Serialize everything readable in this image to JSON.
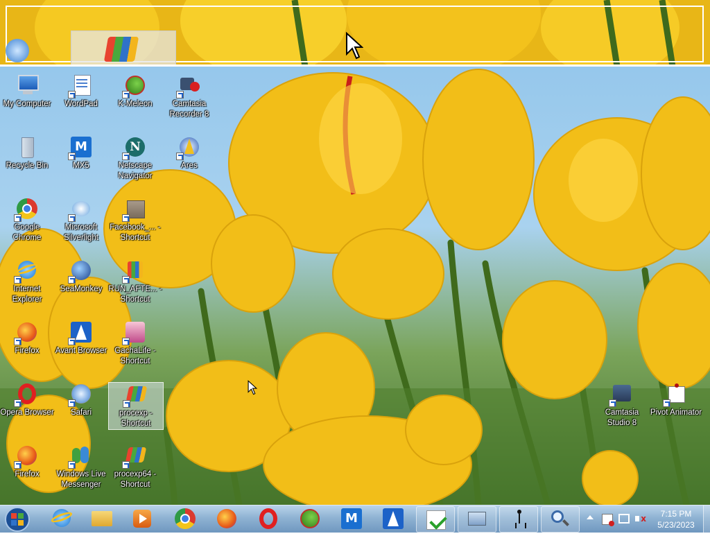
{
  "desktop_icons": [
    {
      "id": "my-computer",
      "label": "My Computer",
      "icon": "computer-icon"
    },
    {
      "id": "wordpad",
      "label": "WordPad",
      "icon": "wordpad-icon"
    },
    {
      "id": "k-meleon",
      "label": "K-Meleon",
      "icon": "k-meleon-icon"
    },
    {
      "id": "camtasia-recorder",
      "label": "Camtasia Recorder 8",
      "icon": "camtasia-recorder-icon"
    },
    {
      "id": "recycle-bin",
      "label": "Recycle Bin",
      "icon": "recycle-bin-icon"
    },
    {
      "id": "mx5",
      "label": "MX5",
      "icon": "mx5-icon"
    },
    {
      "id": "netscape",
      "label": "Netscape Navigator",
      "icon": "netscape-icon"
    },
    {
      "id": "ares",
      "label": "Ares",
      "icon": "ares-icon"
    },
    {
      "id": "google-chrome",
      "label": "Google Chrome",
      "icon": "chrome-icon"
    },
    {
      "id": "silverlight",
      "label": "Microsoft Silverlight",
      "icon": "silverlight-icon"
    },
    {
      "id": "facebook-shortcut",
      "label": "Facebook_... - Shortcut",
      "icon": "package-icon"
    },
    {
      "id": "internet-explorer",
      "label": "Internet Explorer",
      "icon": "ie-icon"
    },
    {
      "id": "seamonkey",
      "label": "SeaMonkey",
      "icon": "seamonkey-icon"
    },
    {
      "id": "run-after-shortcut",
      "label": "RUN_AFTE... - Shortcut",
      "icon": "shield-setup-icon"
    },
    {
      "id": "firefox-1",
      "label": "Firefox",
      "icon": "firefox-icon"
    },
    {
      "id": "avant",
      "label": "Avant Browser",
      "icon": "avant-icon"
    },
    {
      "id": "gachalife",
      "label": "GachaLife - Shortcut",
      "icon": "gachalife-icon"
    },
    {
      "id": "opera",
      "label": "Opera Browser",
      "icon": "opera-icon"
    },
    {
      "id": "safari",
      "label": "Safari",
      "icon": "safari-icon"
    },
    {
      "id": "procexp",
      "label": "procexp - Shortcut",
      "icon": "procexp-icon"
    },
    {
      "id": "firefox-2",
      "label": "Firefox",
      "icon": "firefox-icon"
    },
    {
      "id": "wlm",
      "label": "Windows Live Messenger",
      "icon": "messenger-icon"
    },
    {
      "id": "procexp64",
      "label": "procexp64 - Shortcut",
      "icon": "procexp-icon"
    },
    {
      "id": "camtasia-studio",
      "label": "Camtasia Studio 8",
      "icon": "camtasia-studio-icon"
    },
    {
      "id": "pivot",
      "label": "Pivot Animator",
      "icon": "pivot-icon"
    }
  ],
  "taskbar": {
    "items": [
      "ie-icon",
      "explorer-folder-icon",
      "media-player-icon",
      "chrome-icon",
      "firefox-icon",
      "opera-icon",
      "k-meleon-icon",
      "mx5-icon",
      "avant-icon",
      "setup-shield-icon",
      "remote-desktop-icon",
      "pivot-icon",
      "magnifier-icon"
    ]
  },
  "clock": {
    "time": "7:15 PM",
    "date": "5/23/2023"
  },
  "colors": {
    "accent": "#1c60c8",
    "taskbar": "#8fb3d3",
    "tulip": "#f5c21a"
  }
}
